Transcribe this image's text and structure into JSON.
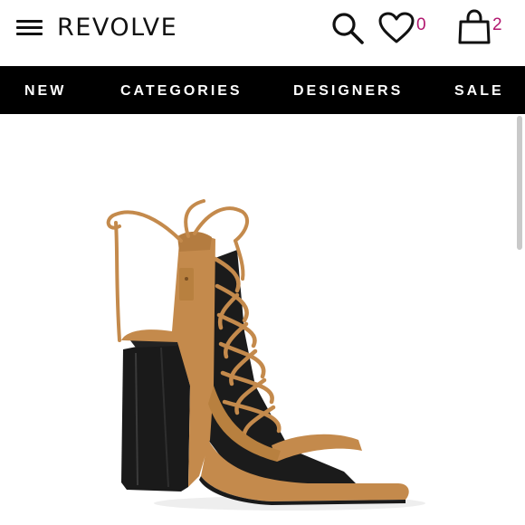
{
  "header": {
    "logo": "REVOLVE",
    "menu_icon": "hamburger-menu-icon",
    "search_icon": "search-icon",
    "wishlist_icon": "heart-icon",
    "wishlist_count": "0",
    "bag_icon": "shopping-bag-icon",
    "bag_count": "2",
    "count_color": "#b1166e"
  },
  "nav": {
    "items": [
      {
        "label": "NEW"
      },
      {
        "label": "CATEGORIES"
      },
      {
        "label": "DESIGNERS"
      },
      {
        "label": "SALE"
      }
    ],
    "background": "#000000"
  },
  "product": {
    "image": "tan suede lace-up block heel sandal",
    "suede_color": "#c48a4c",
    "heel_color": "#1a1a1a"
  }
}
